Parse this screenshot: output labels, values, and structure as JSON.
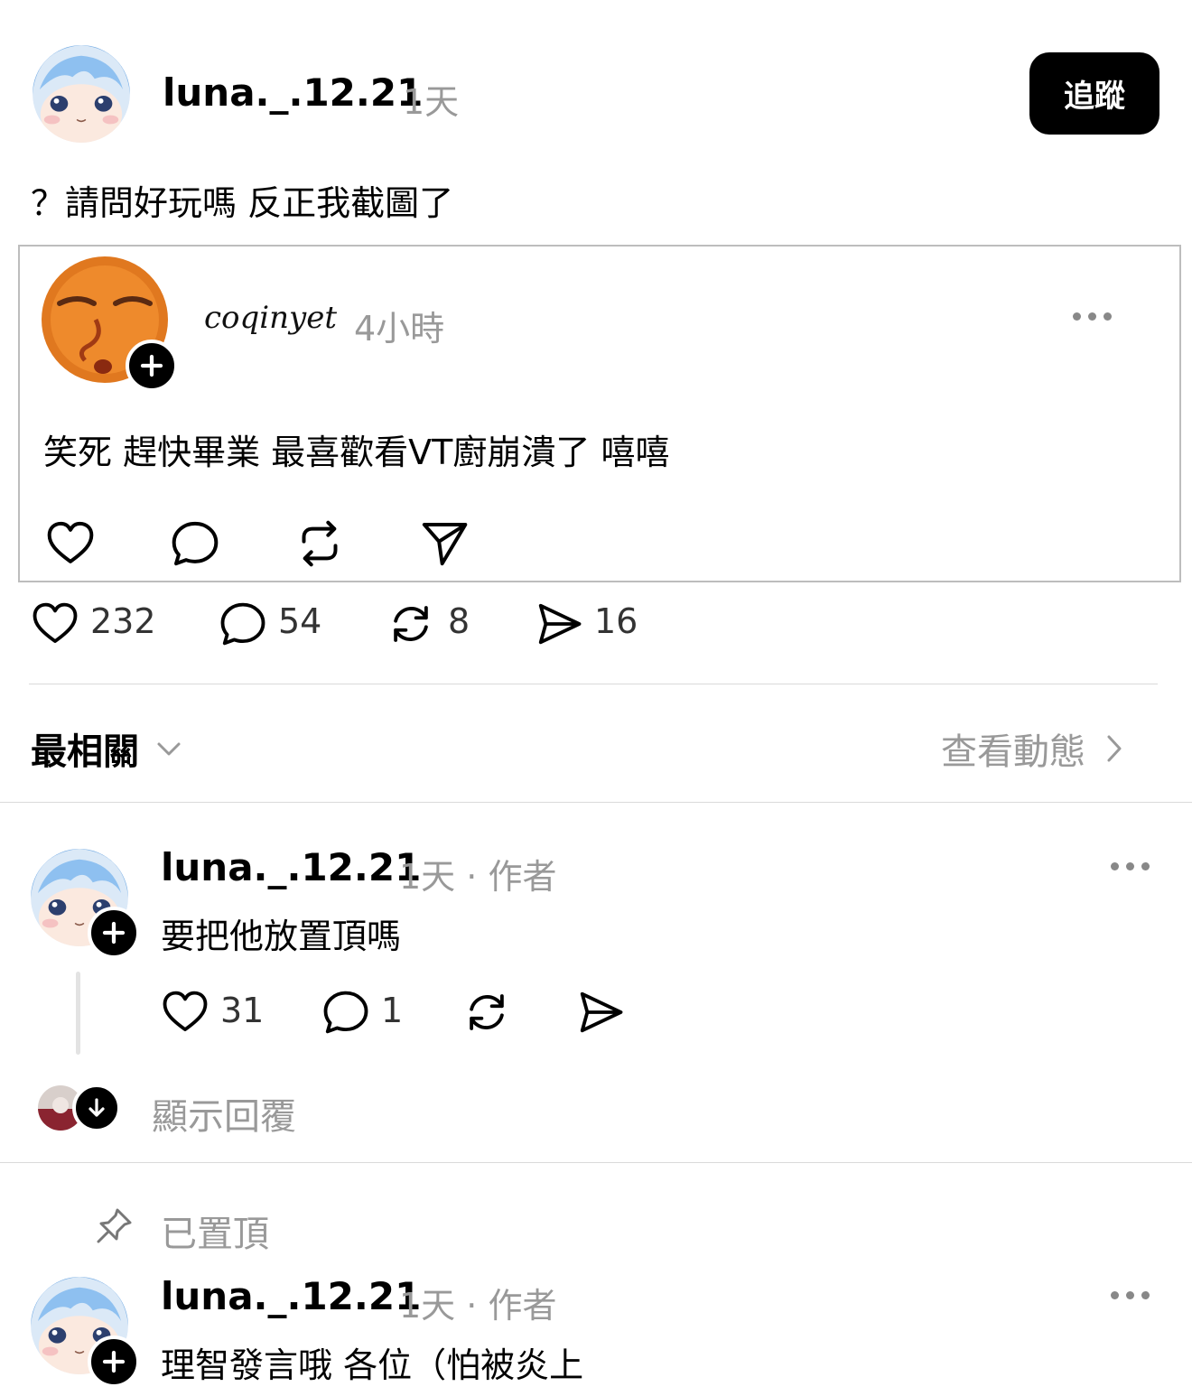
{
  "main_post": {
    "username": "luna._.12.21",
    "time": "1天",
    "follow_label": "追蹤",
    "text": "？請問好玩嗎 反正我截圖了"
  },
  "quoted_post": {
    "username": "coqinyet",
    "time": "4小時",
    "text": "笑死 趕快畢業 最喜歡看VT廚崩潰了 嘻嘻"
  },
  "stats": {
    "likes": "232",
    "comments": "54",
    "reposts": "8",
    "shares": "16"
  },
  "sort": {
    "label": "最相關",
    "view_activity": "查看動態"
  },
  "replies": [
    {
      "username": "luna._.12.21",
      "time": "1天",
      "role": "作者",
      "text": "要把他放置頂嗎",
      "likes": "31",
      "comments": "1",
      "show_replies": "顯示回覆"
    },
    {
      "pinned_label": "已置頂",
      "username": "luna._.12.21",
      "time": "1天",
      "role": "作者",
      "text": "理智發言哦 各位（怕被炎上"
    }
  ],
  "colors": {
    "accent": "#000000",
    "muted_text": "#999999",
    "divider": "#dadada"
  }
}
